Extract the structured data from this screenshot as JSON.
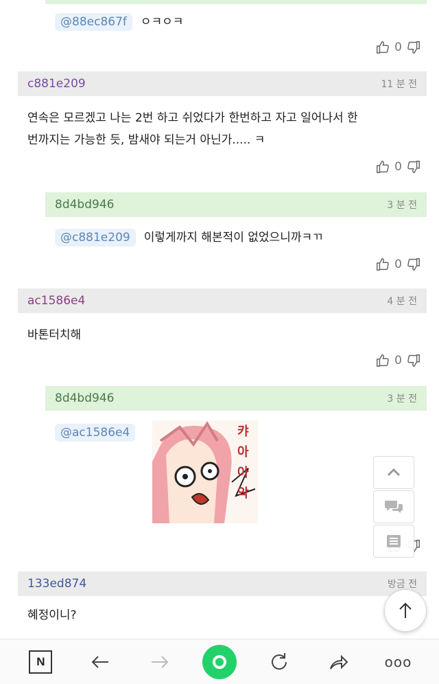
{
  "comments": [
    {
      "mention": "@88ec867f",
      "text": "ㅇㅋㅇㅋ",
      "votes": {
        "up": "0"
      }
    },
    {
      "nick": "c881e209",
      "time": "11 분 전",
      "text_line1": "연속은 모르겠고 나는 2번 하고 쉬었다가 한번하고 자고 일어나서 한",
      "text_line2": "번까지는 가능한 듯, 밤새야 되는거 아닌가..... ㅋ",
      "votes": {
        "up": "0"
      }
    },
    {
      "nick": "8d4bd946",
      "time": "3 분 전",
      "mention": "@c881e209",
      "text": "이렇게까지 해본적이 없었으니까ㅋㄲ",
      "votes": {
        "up": "0"
      }
    },
    {
      "nick": "ac1586e4",
      "time": "4 분 전",
      "text": "바톤터치해",
      "votes": {
        "up": "0"
      }
    },
    {
      "nick": "8d4bd946",
      "time": "3 분 전",
      "mention": "@ac1586e4",
      "sticker_text": [
        "캬",
        "아",
        "아",
        "악"
      ]
    },
    {
      "nick": "133ed874",
      "time": "방금 전",
      "text": "혜정이니?"
    }
  ],
  "floating": {
    "icons": [
      "chevron-up-icon",
      "chat-bubbles-icon",
      "list-icon"
    ]
  },
  "nav": {
    "logo_label": "N",
    "more_label": "ooo"
  },
  "colors": {
    "reply_header": "#dff2da",
    "comment_header": "#ebebeb",
    "mention_bg": "#e9f1fa",
    "accent_green": "#23d16b"
  }
}
